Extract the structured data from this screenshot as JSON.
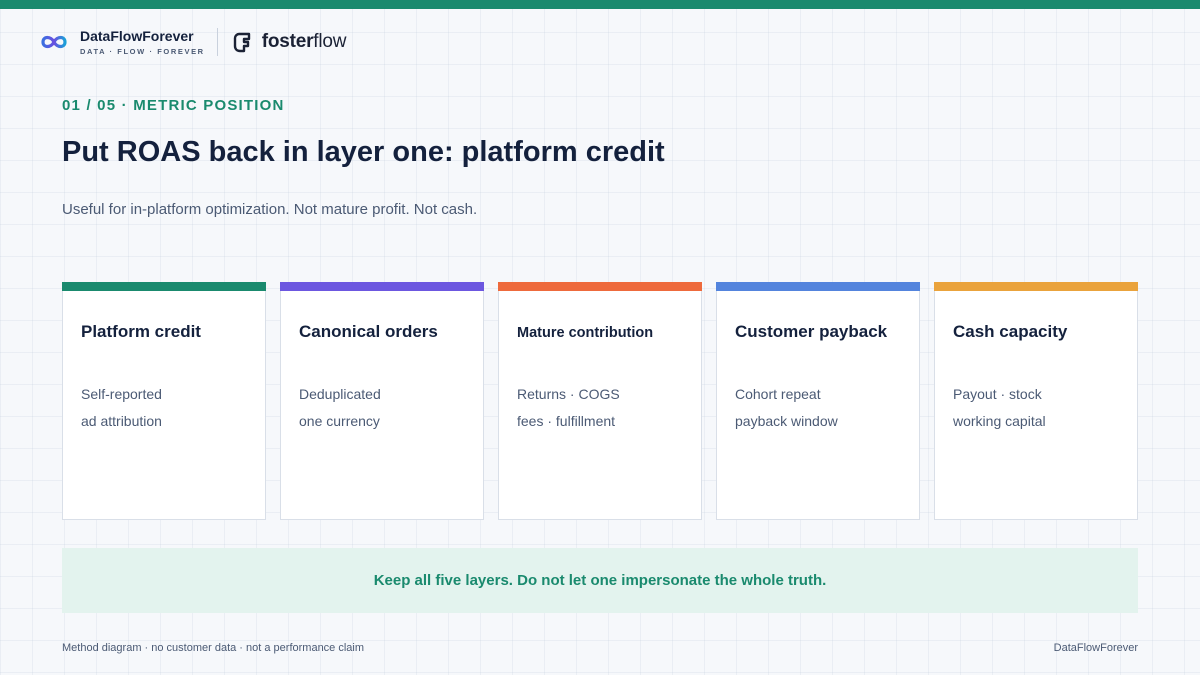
{
  "colors": {
    "accent": "#1a8a6e",
    "layer1": "#1a8a6e",
    "layer2": "#6c57e0",
    "layer3": "#ee6a3c",
    "layer4": "#5384dd",
    "layer5": "#eaa33c",
    "takeaway_bg": "#e3f3ee"
  },
  "brand": {
    "name": "DataFlowForever",
    "tagline": "DATA · FLOW · FOREVER",
    "logo_icon": "infinity-logo-icon"
  },
  "partner": {
    "name_bold": "foster",
    "name_light": "flow",
    "logo_icon": "fosterflow-logo-icon"
  },
  "slide": {
    "eyebrow": "01 / 05 · METRIC POSITION",
    "title": "Put ROAS back in layer one: platform credit",
    "subtitle": "Useful for in-platform optimization. Not mature profit. Not cash."
  },
  "layers": [
    {
      "title": "Platform credit",
      "line1": "Self-reported",
      "line2": "ad attribution"
    },
    {
      "title": "Canonical orders",
      "line1": "Deduplicated",
      "line2": "one currency"
    },
    {
      "title": "Mature contribution",
      "line1": "Returns · COGS",
      "line2": "fees · fulfillment"
    },
    {
      "title": "Customer payback",
      "line1": "Cohort repeat",
      "line2": "payback window"
    },
    {
      "title": "Cash capacity",
      "line1": "Payout · stock",
      "line2": "working capital"
    }
  ],
  "takeaway": "Keep all five layers. Do not let one impersonate the whole truth.",
  "footer": {
    "left": "Method diagram · no customer data · not a performance claim",
    "right": "DataFlowForever"
  }
}
